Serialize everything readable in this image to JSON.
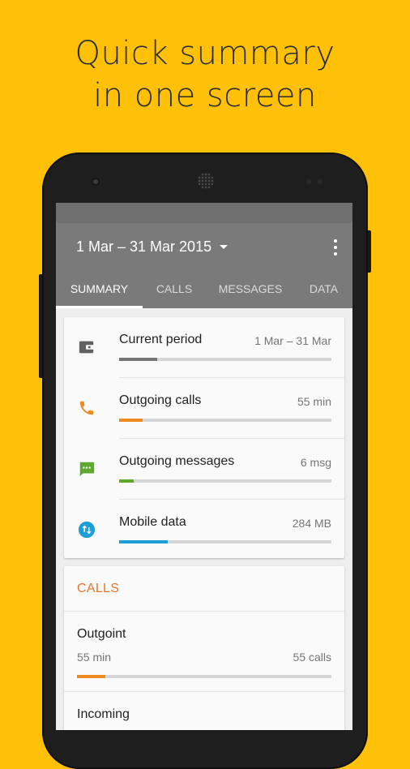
{
  "headline": {
    "line1": "Quick summary",
    "line2": "in one screen"
  },
  "app": {
    "date_range": "1 Mar – 31 Mar 2015",
    "tabs": [
      {
        "label": "SUMMARY",
        "active": true
      },
      {
        "label": "CALLS",
        "active": false
      },
      {
        "label": "MESSAGES",
        "active": false
      },
      {
        "label": "DATA",
        "active": false
      }
    ]
  },
  "summary": [
    {
      "label": "Current period",
      "value": "1 Mar – 31 Mar",
      "icon": "wallet-icon",
      "progress": 0.18,
      "color": "#757575"
    },
    {
      "label": "Outgoing calls",
      "value": "55 min",
      "icon": "phone-icon",
      "progress": 0.11,
      "color": "#EF8A1F"
    },
    {
      "label": "Outgoing messages",
      "value": "6 msg",
      "icon": "message-icon",
      "progress": 0.07,
      "color": "#5FA830"
    },
    {
      "label": "Mobile data",
      "value": "284 MB",
      "icon": "data-transfer-icon",
      "progress": 0.23,
      "color": "#1E9ED8"
    }
  ],
  "calls": {
    "heading": "CALLS",
    "outgoing": {
      "title": "Outgoint",
      "time": "55 min",
      "calls": "55 calls",
      "progress": 0.11,
      "color": "#EF8A1F"
    },
    "incoming": {
      "title": "Incoming"
    }
  }
}
